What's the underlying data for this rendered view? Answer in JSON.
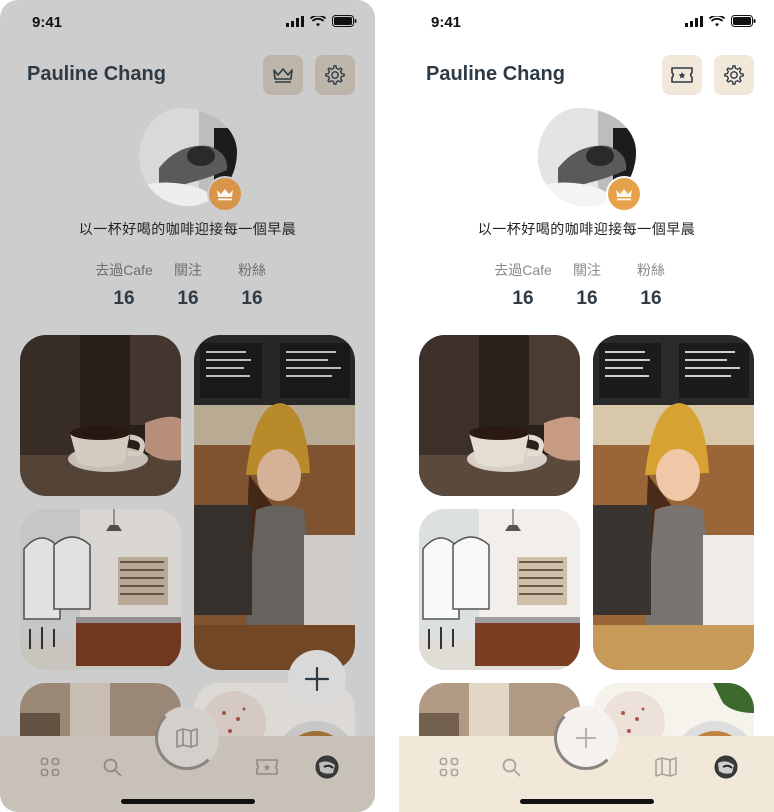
{
  "status": {
    "time": "9:41"
  },
  "profile": {
    "name": "Pauline Chang",
    "bio": "以一杯好喝的咖啡迎接每一個早晨"
  },
  "stats": [
    {
      "label": "去過Cafe",
      "value": "16"
    },
    {
      "label": "關注",
      "value": "16"
    },
    {
      "label": "粉絲",
      "value": "16"
    }
  ],
  "screens": {
    "left": {
      "header_icons": [
        "crown-icon",
        "gear-icon"
      ],
      "center_tab_icon": "map-icon",
      "floating_icon": "plus-icon"
    },
    "right": {
      "header_icons": [
        "ticket-icon",
        "gear-icon"
      ],
      "center_tab_icon": "plus-icon"
    }
  },
  "tab_bar": {
    "left": [
      "grid-icon",
      "search-icon",
      "map-icon",
      "ticket-icon",
      "avatar"
    ],
    "right": [
      "grid-icon",
      "search-icon",
      "plus-icon",
      "map-icon",
      "avatar"
    ]
  },
  "colors": {
    "accent": "#e6a24b",
    "cream": "#f2e8da",
    "text_dark": "#2e3a44",
    "overlay_gray": "#cdcdcd"
  }
}
